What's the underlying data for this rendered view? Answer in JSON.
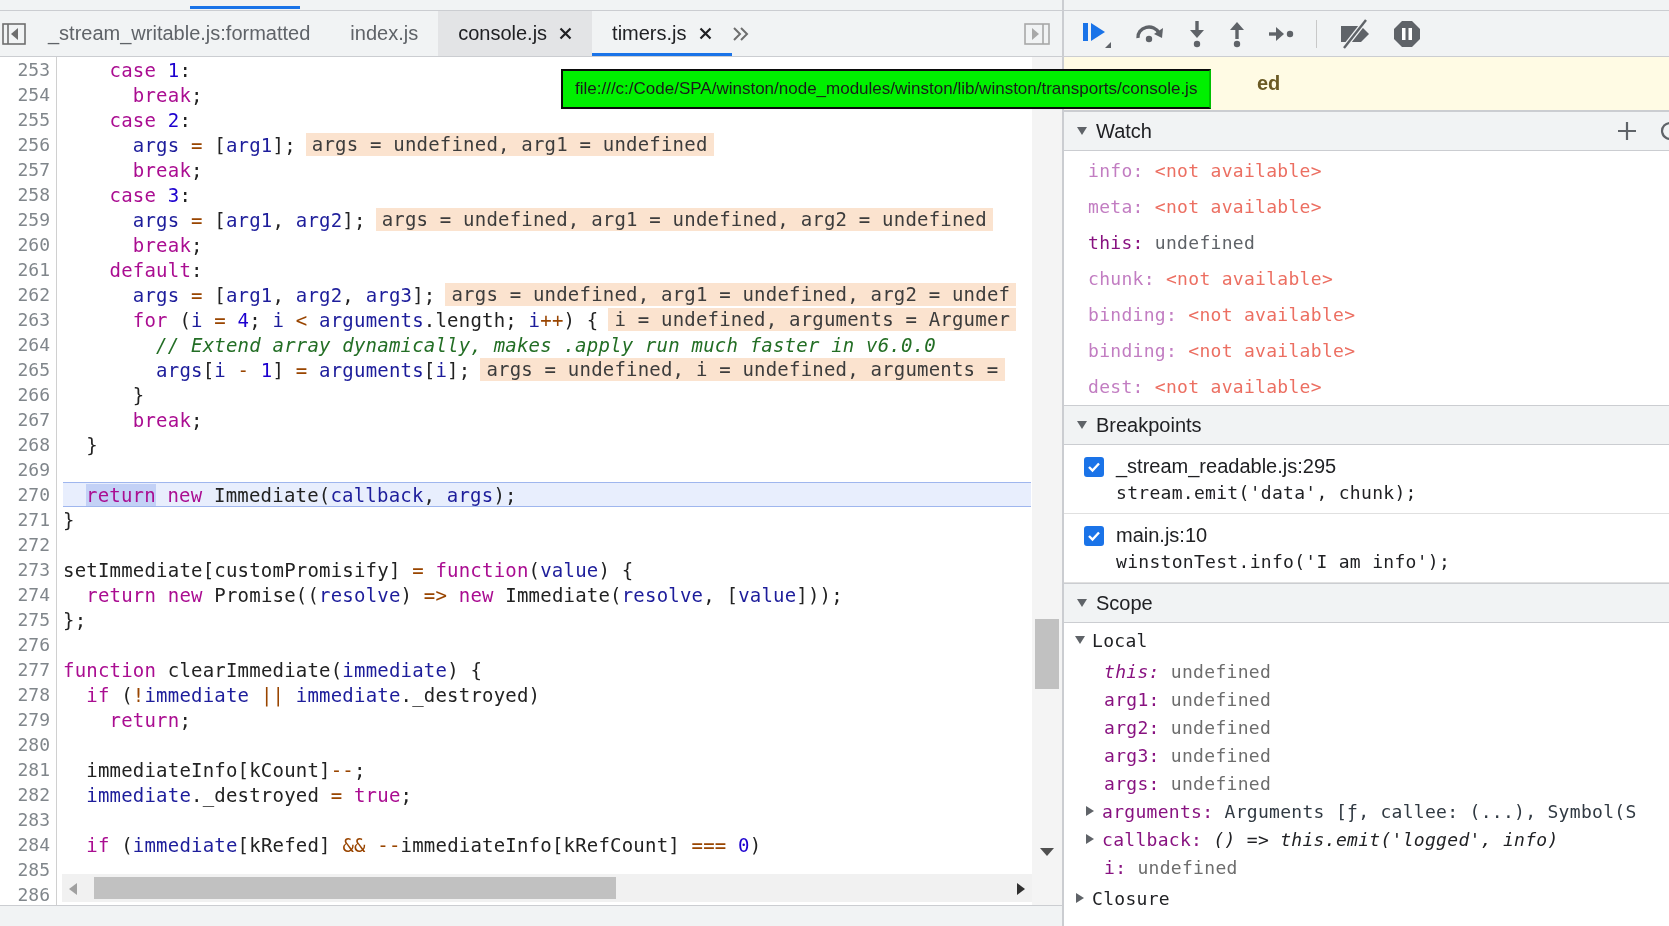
{
  "source_tabs": [
    {
      "label": "_stream_writable.js:formatted",
      "selected": false,
      "hovered": false,
      "closable": false
    },
    {
      "label": "index.js",
      "selected": false,
      "hovered": false,
      "closable": false
    },
    {
      "label": "console.js",
      "selected": false,
      "hovered": true,
      "closable": true
    },
    {
      "label": "timers.js",
      "selected": true,
      "hovered": false,
      "closable": true
    }
  ],
  "tooltip": {
    "text": "file:///c:/Code/SPA/winston/node_modules/winston/lib/winston/transports/console.js"
  },
  "editor": {
    "lines": [
      {
        "number": "253",
        "current": false,
        "tokens": [
          {
            "kind": "keyword",
            "text": "    case"
          },
          {
            "kind": "number",
            "text": " 1"
          },
          {
            "kind": "plain",
            "text": ":"
          }
        ]
      },
      {
        "number": "254",
        "current": false,
        "tokens": [
          {
            "kind": "keyword",
            "text": "      break"
          },
          {
            "kind": "plain",
            "text": ";"
          }
        ]
      },
      {
        "number": "255",
        "current": false,
        "tokens": [
          {
            "kind": "keyword",
            "text": "    case"
          },
          {
            "kind": "number",
            "text": " 2"
          },
          {
            "kind": "plain",
            "text": ":"
          }
        ]
      },
      {
        "number": "256",
        "current": false,
        "tokens": [
          {
            "kind": "variable",
            "text": "      args"
          },
          {
            "kind": "operator",
            "text": " ="
          },
          {
            "kind": "plain",
            "text": " ["
          },
          {
            "kind": "variable",
            "text": "arg1"
          },
          {
            "kind": "plain",
            "text": "];"
          }
        ],
        "hint": "args = undefined, arg1 = undefined"
      },
      {
        "number": "257",
        "current": false,
        "tokens": [
          {
            "kind": "keyword",
            "text": "      break"
          },
          {
            "kind": "plain",
            "text": ";"
          }
        ]
      },
      {
        "number": "258",
        "current": false,
        "tokens": [
          {
            "kind": "keyword",
            "text": "    case"
          },
          {
            "kind": "number",
            "text": " 3"
          },
          {
            "kind": "plain",
            "text": ":"
          }
        ]
      },
      {
        "number": "259",
        "current": false,
        "tokens": [
          {
            "kind": "variable",
            "text": "      args"
          },
          {
            "kind": "operator",
            "text": " ="
          },
          {
            "kind": "plain",
            "text": " ["
          },
          {
            "kind": "variable",
            "text": "arg1"
          },
          {
            "kind": "plain",
            "text": ", "
          },
          {
            "kind": "variable",
            "text": "arg2"
          },
          {
            "kind": "plain",
            "text": "];"
          }
        ],
        "hint": "args = undefined, arg1 = undefined, arg2 = undefined"
      },
      {
        "number": "260",
        "current": false,
        "tokens": [
          {
            "kind": "keyword",
            "text": "      break"
          },
          {
            "kind": "plain",
            "text": ";"
          }
        ]
      },
      {
        "number": "261",
        "current": false,
        "tokens": [
          {
            "kind": "keyword",
            "text": "    default"
          },
          {
            "kind": "plain",
            "text": ":"
          }
        ]
      },
      {
        "number": "262",
        "current": false,
        "tokens": [
          {
            "kind": "variable",
            "text": "      args"
          },
          {
            "kind": "operator",
            "text": " ="
          },
          {
            "kind": "plain",
            "text": " ["
          },
          {
            "kind": "variable",
            "text": "arg1"
          },
          {
            "kind": "plain",
            "text": ", "
          },
          {
            "kind": "variable",
            "text": "arg2"
          },
          {
            "kind": "plain",
            "text": ", "
          },
          {
            "kind": "variable",
            "text": "arg3"
          },
          {
            "kind": "plain",
            "text": "];"
          }
        ],
        "hint": "args = undefined, arg1 = undefined, arg2 = undef"
      },
      {
        "number": "263",
        "current": false,
        "tokens": [
          {
            "kind": "keyword",
            "text": "      for"
          },
          {
            "kind": "plain",
            "text": " ("
          },
          {
            "kind": "variable",
            "text": "i"
          },
          {
            "kind": "operator",
            "text": " ="
          },
          {
            "kind": "number",
            "text": " 4"
          },
          {
            "kind": "plain",
            "text": "; "
          },
          {
            "kind": "variable",
            "text": "i"
          },
          {
            "kind": "operator",
            "text": " <"
          },
          {
            "kind": "variable",
            "text": " arguments"
          },
          {
            "kind": "plain",
            "text": ".length; "
          },
          {
            "kind": "variable",
            "text": "i"
          },
          {
            "kind": "operator",
            "text": "++"
          },
          {
            "kind": "plain",
            "text": ") {"
          }
        ],
        "hint": "i = undefined, arguments = Argumer"
      },
      {
        "number": "264",
        "current": false,
        "tokens": [
          {
            "kind": "comment",
            "text": "        // Extend array dynamically, makes .apply run much faster in v6.0.0"
          }
        ]
      },
      {
        "number": "265",
        "current": false,
        "tokens": [
          {
            "kind": "variable",
            "text": "        args"
          },
          {
            "kind": "plain",
            "text": "["
          },
          {
            "kind": "variable",
            "text": "i"
          },
          {
            "kind": "operator",
            "text": " -"
          },
          {
            "kind": "number",
            "text": " 1"
          },
          {
            "kind": "plain",
            "text": "] "
          },
          {
            "kind": "operator",
            "text": "="
          },
          {
            "kind": "variable",
            "text": " arguments"
          },
          {
            "kind": "plain",
            "text": "["
          },
          {
            "kind": "variable",
            "text": "i"
          },
          {
            "kind": "plain",
            "text": "];"
          }
        ],
        "hint": "args = undefined, i = undefined, arguments ="
      },
      {
        "number": "266",
        "current": false,
        "tokens": [
          {
            "kind": "plain",
            "text": "      }"
          }
        ]
      },
      {
        "number": "267",
        "current": false,
        "tokens": [
          {
            "kind": "keyword",
            "text": "      break"
          },
          {
            "kind": "plain",
            "text": ";"
          }
        ]
      },
      {
        "number": "268",
        "current": false,
        "tokens": [
          {
            "kind": "plain",
            "text": "  }"
          }
        ]
      },
      {
        "number": "269",
        "current": false
      },
      {
        "number": "270",
        "current": true,
        "tokens": [
          {
            "kind": "selected_keyword",
            "text": "return"
          },
          {
            "kind": "keyword",
            "text": " new"
          },
          {
            "kind": "plain",
            "text": " Immediate("
          },
          {
            "kind": "variable",
            "text": "callback"
          },
          {
            "kind": "plain",
            "text": ", "
          },
          {
            "kind": "variable",
            "text": "args"
          },
          {
            "kind": "plain",
            "text": ");"
          }
        ]
      },
      {
        "number": "271",
        "current": false,
        "tokens": [
          {
            "kind": "plain",
            "text": "}"
          }
        ]
      },
      {
        "number": "272",
        "current": false
      },
      {
        "number": "273",
        "current": false,
        "tokens": [
          {
            "kind": "plain",
            "text": "setImmediate[customPromisify] "
          },
          {
            "kind": "operator",
            "text": "="
          },
          {
            "kind": "keyword",
            "text": " function"
          },
          {
            "kind": "plain",
            "text": "("
          },
          {
            "kind": "variable",
            "text": "value"
          },
          {
            "kind": "plain",
            "text": ") {"
          }
        ]
      },
      {
        "number": "274",
        "current": false,
        "tokens": [
          {
            "kind": "keyword",
            "text": "  return"
          },
          {
            "kind": "keyword",
            "text": " new"
          },
          {
            "kind": "plain",
            "text": " Promise(("
          },
          {
            "kind": "variable",
            "text": "resolve"
          },
          {
            "kind": "plain",
            "text": ") "
          },
          {
            "kind": "operator",
            "text": "=>"
          },
          {
            "kind": "keyword",
            "text": " new"
          },
          {
            "kind": "plain",
            "text": " Immediate("
          },
          {
            "kind": "variable",
            "text": "resolve"
          },
          {
            "kind": "plain",
            "text": ", ["
          },
          {
            "kind": "variable",
            "text": "value"
          },
          {
            "kind": "plain",
            "text": "]));"
          }
        ]
      },
      {
        "number": "275",
        "current": false,
        "tokens": [
          {
            "kind": "plain",
            "text": "};"
          }
        ]
      },
      {
        "number": "276",
        "current": false
      },
      {
        "number": "277",
        "current": false,
        "tokens": [
          {
            "kind": "keyword",
            "text": "function"
          },
          {
            "kind": "plain",
            "text": " clearImmediate("
          },
          {
            "kind": "variable",
            "text": "immediate"
          },
          {
            "kind": "plain",
            "text": ") {"
          }
        ]
      },
      {
        "number": "278",
        "current": false,
        "tokens": [
          {
            "kind": "keyword",
            "text": "  if"
          },
          {
            "kind": "plain",
            "text": " ("
          },
          {
            "kind": "operator",
            "text": "!"
          },
          {
            "kind": "variable",
            "text": "immediate"
          },
          {
            "kind": "operator",
            "text": " ||"
          },
          {
            "kind": "variable",
            "text": " immediate"
          },
          {
            "kind": "plain",
            "text": "._destroyed)"
          }
        ]
      },
      {
        "number": "279",
        "current": false,
        "tokens": [
          {
            "kind": "keyword",
            "text": "    return"
          },
          {
            "kind": "plain",
            "text": ";"
          }
        ]
      },
      {
        "number": "280",
        "current": false
      },
      {
        "number": "281",
        "current": false,
        "tokens": [
          {
            "kind": "plain",
            "text": "  immediateInfo[kCount]"
          },
          {
            "kind": "operator",
            "text": "--"
          },
          {
            "kind": "plain",
            "text": ";"
          }
        ]
      },
      {
        "number": "282",
        "current": false,
        "tokens": [
          {
            "kind": "variable",
            "text": "  immediate"
          },
          {
            "kind": "plain",
            "text": "._destroyed "
          },
          {
            "kind": "operator",
            "text": "="
          },
          {
            "kind": "keyword",
            "text": " true"
          },
          {
            "kind": "plain",
            "text": ";"
          }
        ]
      },
      {
        "number": "283",
        "current": false
      },
      {
        "number": "284",
        "current": false,
        "tokens": [
          {
            "kind": "keyword",
            "text": "  if"
          },
          {
            "kind": "plain",
            "text": " ("
          },
          {
            "kind": "variable",
            "text": "immediate"
          },
          {
            "kind": "plain",
            "text": "[kRefed] "
          },
          {
            "kind": "operator",
            "text": "&&"
          },
          {
            "kind": "operator",
            "text": " --"
          },
          {
            "kind": "plain",
            "text": "immediateInfo[kRefCount] "
          },
          {
            "kind": "operator",
            "text": "==="
          },
          {
            "kind": "number",
            "text": " 0"
          },
          {
            "kind": "plain",
            "text": ")"
          }
        ]
      },
      {
        "number": "285",
        "current": false
      },
      {
        "number": "286",
        "current": false
      }
    ]
  },
  "debugger": {
    "banner": {
      "text": "ed"
    },
    "watch": {
      "title": "Watch",
      "expanded": true,
      "items": [
        {
          "name": "info:",
          "value": "<not available>",
          "available": false
        },
        {
          "name": "meta:",
          "value": "<not available>",
          "available": false
        },
        {
          "name": "this:",
          "value": "undefined",
          "available": true
        },
        {
          "name": "chunk:",
          "value": "<not available>",
          "available": false
        },
        {
          "name": "binding:",
          "value": "<not available>",
          "available": false
        },
        {
          "name": "binding:",
          "value": "<not available>",
          "available": false
        },
        {
          "name": "dest:",
          "value": "<not available>",
          "available": false
        }
      ]
    },
    "breakpoints": {
      "title": "Breakpoints",
      "expanded": true,
      "items": [
        {
          "location": "_stream_readable.js:295",
          "code": "stream.emit('data', chunk);",
          "checked": true
        },
        {
          "location": "main.js:10",
          "code": "winstonTest.info('I am info');",
          "checked": true
        }
      ]
    },
    "scope": {
      "title": "Scope",
      "expanded": true,
      "groups": [
        {
          "name": "Local",
          "expanded": true,
          "items": [
            {
              "name": "this:",
              "value": "undefined",
              "kind": "receiver"
            },
            {
              "name": "arg1:",
              "value": "undefined",
              "kind": "value"
            },
            {
              "name": "arg2:",
              "value": "undefined",
              "kind": "value"
            },
            {
              "name": "arg3:",
              "value": "undefined",
              "kind": "value"
            },
            {
              "name": "args:",
              "value": "undefined",
              "kind": "value"
            },
            {
              "name": "arguments:",
              "value": "Arguments [ƒ, callee: (...), Symbol(S",
              "kind": "object",
              "expanded": false
            },
            {
              "name": "callback:",
              "value": "() => this.emit('logged', info)",
              "kind": "function",
              "expanded": false
            },
            {
              "name": "i:",
              "value": "undefined",
              "kind": "value"
            }
          ]
        },
        {
          "name": "Closure",
          "expanded": false
        }
      ]
    }
  }
}
